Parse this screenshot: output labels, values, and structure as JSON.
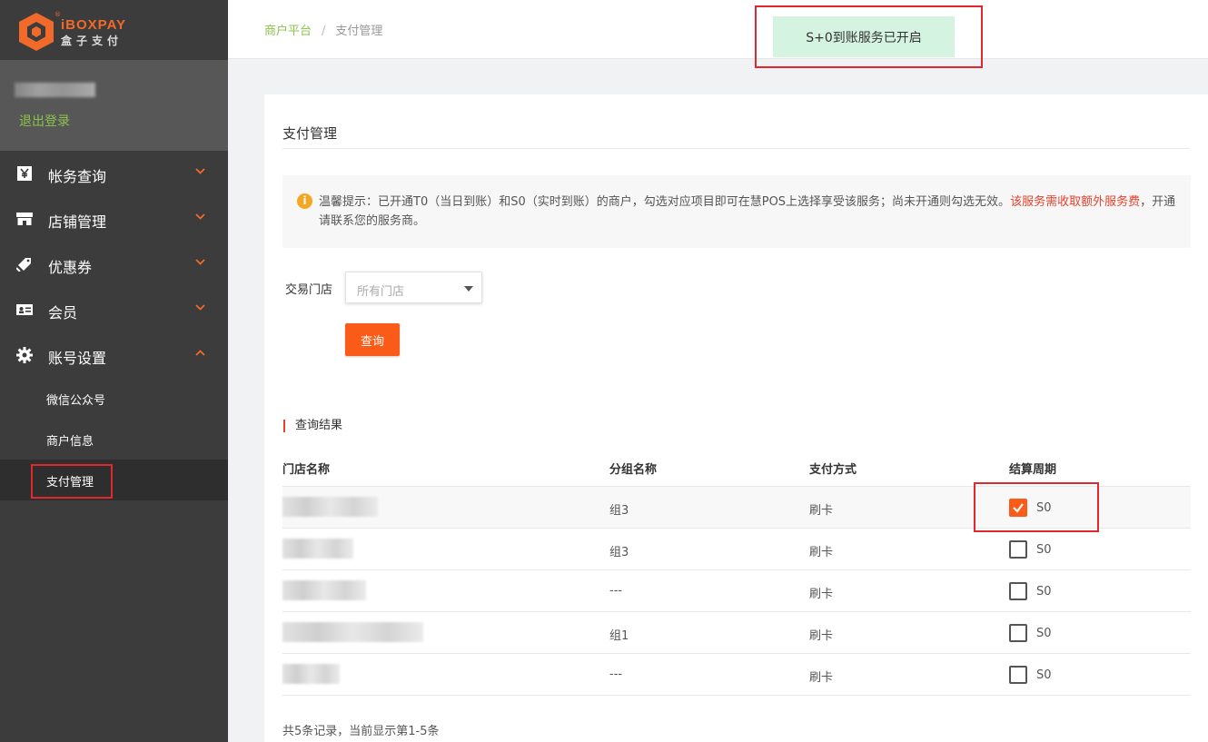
{
  "brand": {
    "name_en": "iBOXPAY",
    "name_cn": "盒子支付",
    "reg": "®",
    "accent": "#f26a2a"
  },
  "user": {
    "logout_label": "退出登录"
  },
  "nav": {
    "items": [
      {
        "label": "帐务查询",
        "icon": "yen-icon",
        "expanded": false
      },
      {
        "label": "店铺管理",
        "icon": "store-icon",
        "expanded": false
      },
      {
        "label": "优惠券",
        "icon": "coupon-icon",
        "expanded": false
      },
      {
        "label": "会员",
        "icon": "member-card-icon",
        "expanded": false
      },
      {
        "label": "账号设置",
        "icon": "gear-icon",
        "expanded": true
      }
    ],
    "sub_items": [
      {
        "label": "微信公众号",
        "active": false
      },
      {
        "label": "商户信息",
        "active": false
      },
      {
        "label": "支付管理",
        "active": true
      }
    ]
  },
  "breadcrumb": {
    "home": "商户平台",
    "sep": "/",
    "current": "支付管理"
  },
  "toast": {
    "text": "S+0到账服务已开启",
    "color": "#d4f3e0"
  },
  "page": {
    "title": "支付管理",
    "notice": {
      "text": "温馨提示：已开通T0（当日到账）和S0（实时到账）的商户，勾选对应项目即可在慧POS上选择享受该服务；尚未开通则勾选无效。",
      "warn": "该服务需收取额外服务费",
      "tail": "，开通请联系您的服务商。"
    },
    "filter": {
      "label": "交易门店",
      "select_value": "所有门店"
    },
    "query_button": "查询",
    "result_title": "查询结果",
    "table": {
      "headers": [
        "门店名称",
        "分组名称",
        "支付方式",
        "结算周期"
      ],
      "rows": [
        {
          "group": "组3",
          "pay": "刷卡",
          "cycle": "S0",
          "checked": true
        },
        {
          "group": "组3",
          "pay": "刷卡",
          "cycle": "S0",
          "checked": false
        },
        {
          "group": "---",
          "pay": "刷卡",
          "cycle": "S0",
          "checked": false
        },
        {
          "group": "组1",
          "pay": "刷卡",
          "cycle": "S0",
          "checked": false
        },
        {
          "group": "---",
          "pay": "刷卡",
          "cycle": "S0",
          "checked": false
        }
      ]
    },
    "footer": "共5条记录，当前显示第1-5条"
  },
  "colors": {
    "primary_button": "#fb5b19",
    "link_green": "#8bc34a",
    "warn_red": "#e5412b",
    "sidebar": "#3c3c3c"
  }
}
